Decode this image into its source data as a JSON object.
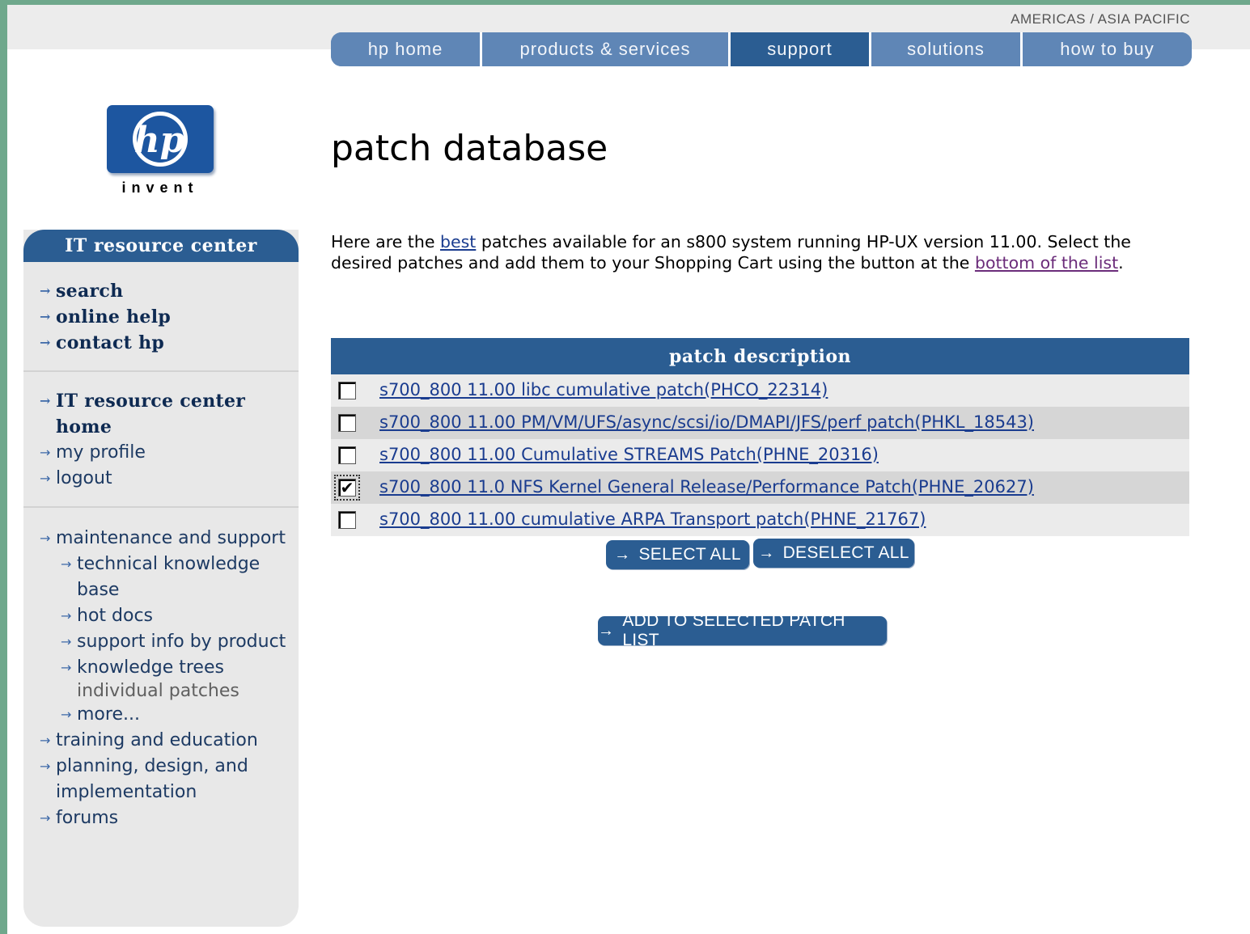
{
  "header": {
    "region_link": "AMERICAS / ASIA PACIFIC",
    "nav": [
      {
        "label": "hp home",
        "active": false
      },
      {
        "label": "products & services",
        "active": false
      },
      {
        "label": "support",
        "active": true
      },
      {
        "label": "solutions",
        "active": false
      },
      {
        "label": "how to buy",
        "active": false
      }
    ]
  },
  "logo": {
    "text": "hp",
    "tagline": "invent"
  },
  "sidebar": {
    "title": "IT resource center",
    "group1": [
      "search",
      "online help",
      "contact hp"
    ],
    "group2": {
      "home": "IT resource center home",
      "items": [
        "my profile",
        "logout"
      ]
    },
    "group3": {
      "maintenance": "maintenance and support",
      "sub": [
        "technical knowledge base",
        "hot docs",
        "support info by product",
        "knowledge trees"
      ],
      "current": "individual patches",
      "more": "more...",
      "items": [
        "training and education",
        "planning, design, and implementation",
        "forums"
      ]
    }
  },
  "main": {
    "title": "patch database",
    "intro": {
      "p1": "Here are the ",
      "link1": "best",
      "p2": " patches available for an s800 system running HP-UX version 11.00. Select the desired patches and add them to your Shopping Cart using the button at the ",
      "link2": "bottom of the list",
      "p3": "."
    },
    "table": {
      "header": "patch description",
      "rows": [
        {
          "label": "s700_800 11.00 libc cumulative patch(PHCO_22314)",
          "checked": false
        },
        {
          "label": "s700_800 11.00 PM/VM/UFS/async/scsi/io/DMAPI/JFS/perf patch(PHKL_18543)",
          "checked": false
        },
        {
          "label": "s700_800 11.00 Cumulative STREAMS Patch(PHNE_20316)",
          "checked": false
        },
        {
          "label": "s700_800 11.0 NFS Kernel General Release/Performance Patch(PHNE_20627)",
          "checked": true
        },
        {
          "label": "s700_800 11.00 cumulative ARPA Transport patch(PHNE_21767)",
          "checked": false
        }
      ]
    },
    "buttons": {
      "select_all": "SELECT ALL",
      "deselect_all": "DESELECT ALL",
      "add": "ADD TO SELECTED PATCH LIST"
    }
  },
  "colors": {
    "primary": "#2b5d92",
    "nav": "#5f86b6",
    "frame": "#6fa88c",
    "link": "#1a3c8f"
  }
}
